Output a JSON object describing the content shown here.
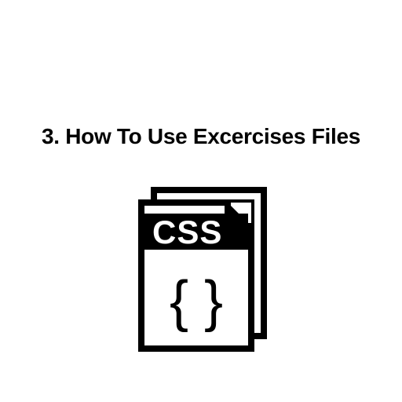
{
  "title": "3. How To Use Excercises Files",
  "icon": {
    "name": "css-file-icon",
    "label": "CSS",
    "braces": "{ }"
  }
}
